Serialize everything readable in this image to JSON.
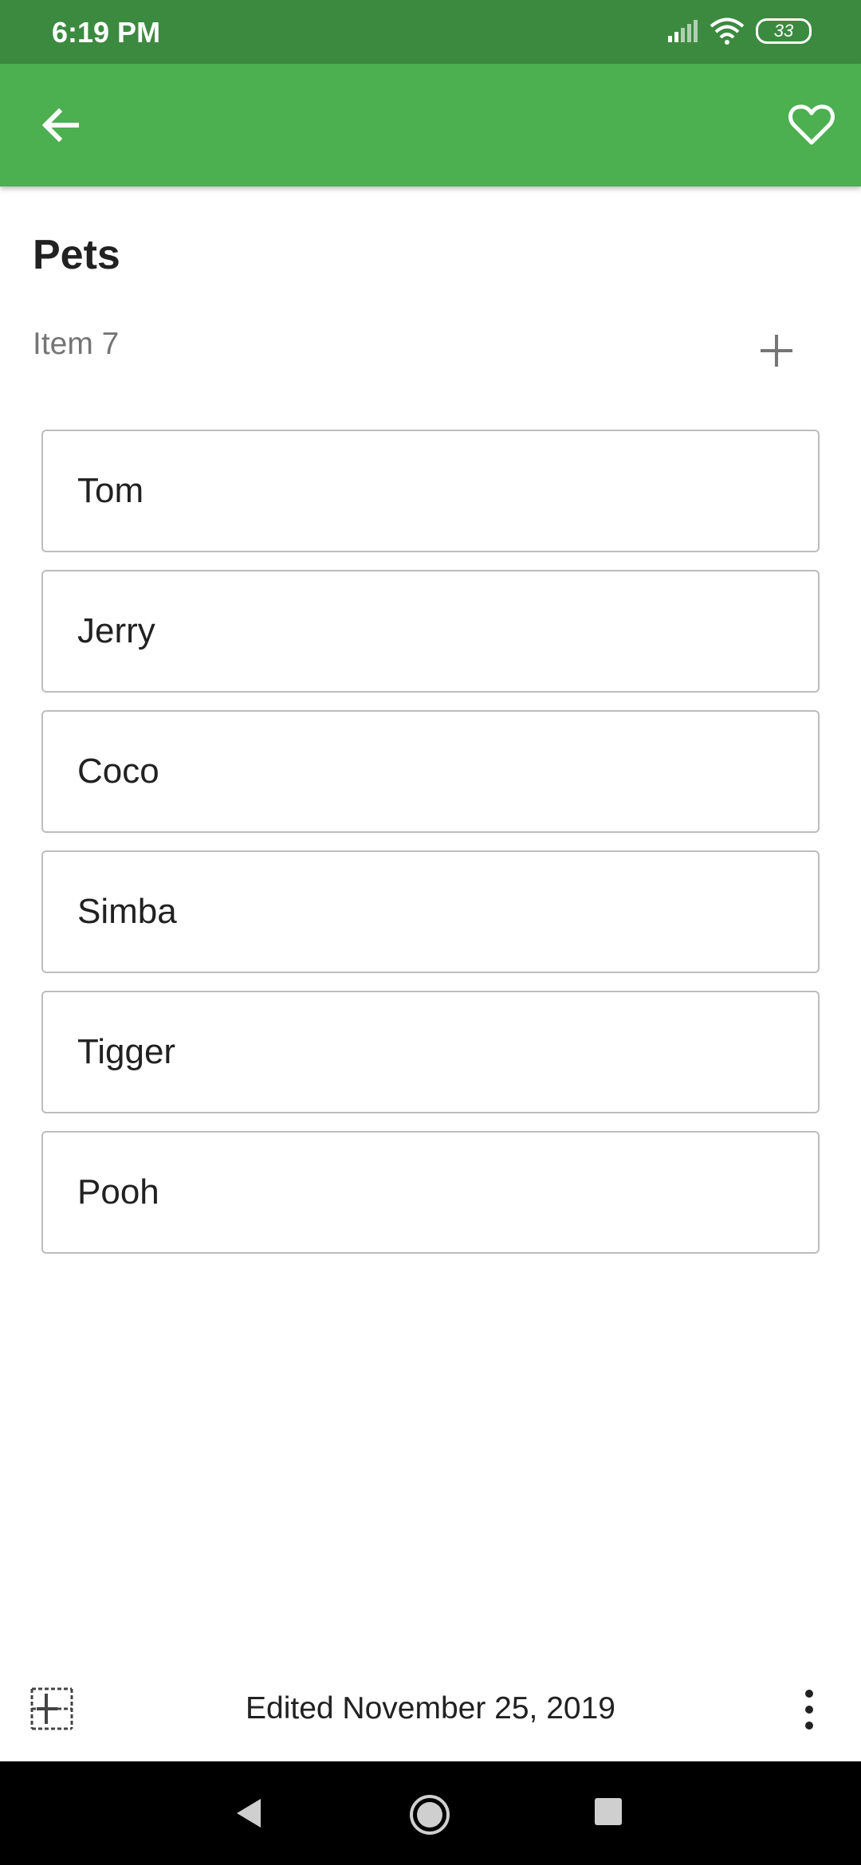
{
  "status_bar": {
    "time": "6:19 PM",
    "battery": "33",
    "icons": [
      "signal-icon",
      "wifi-icon",
      "battery-icon"
    ]
  },
  "app_bar": {
    "back_icon": "arrow-back-icon",
    "favorite_icon": "heart-outline-icon",
    "color": "#4caf50"
  },
  "content": {
    "title": "Pets",
    "item_label": "Item 7",
    "add_icon": "plus-icon",
    "items": [
      {
        "label": "Tom"
      },
      {
        "label": "Jerry"
      },
      {
        "label": "Coco"
      },
      {
        "label": "Simba"
      },
      {
        "label": "Tigger"
      },
      {
        "label": "Pooh"
      }
    ]
  },
  "bottom_bar": {
    "grid_icon": "grid-icon",
    "edited_text": "Edited November 25, 2019",
    "more_icon": "more-vert-icon"
  },
  "nav_bar": {
    "icons": [
      "nav-back-icon",
      "nav-home-icon",
      "nav-recents-icon"
    ]
  }
}
